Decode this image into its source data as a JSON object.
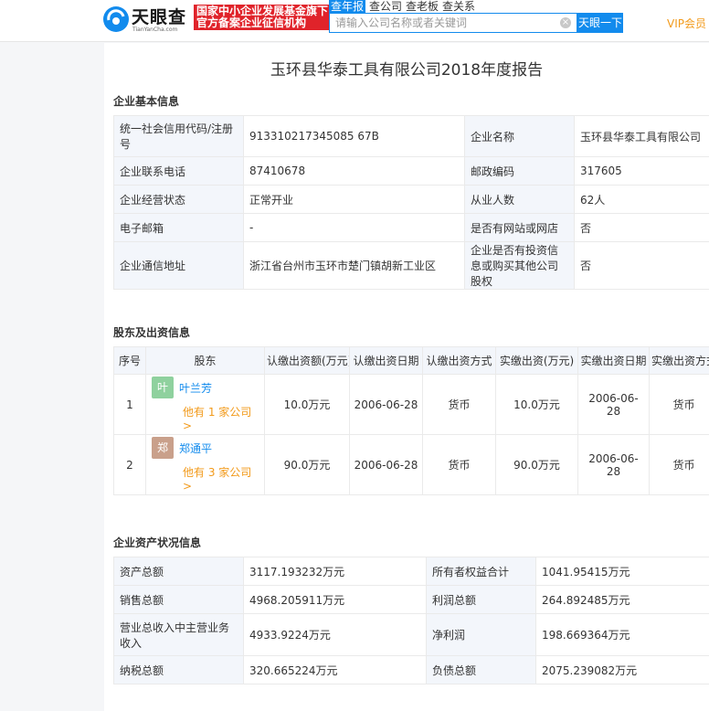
{
  "header": {
    "logo_text": "天眼查",
    "logo_sub": "TianYanCha.com",
    "badge_line1": "国家中小企业发展基金旗下",
    "badge_line2": "官方备案企业征信机构",
    "tabs": [
      "查年报",
      "查公司",
      "查老板",
      "查关系"
    ],
    "search_placeholder": "请输入公司名称或者关键词",
    "search_button": "天眼一下",
    "vip": "VIP会员",
    "accent_color": "#128bed"
  },
  "report": {
    "title": "玉环县华泰工具有限公司2018年度报告"
  },
  "basic": {
    "section_title": "企业基本信息",
    "rows": [
      [
        "统一社会信用代码/注册号",
        "913310217345085 67B",
        "企业名称",
        "玉环县华泰工具有限公司"
      ],
      [
        "企业联系电话",
        "87410678",
        "邮政编码",
        "317605"
      ],
      [
        "企业经营状态",
        "正常开业",
        "从业人数",
        "62人"
      ],
      [
        "电子邮箱",
        "-",
        "是否有网站或网店",
        "否"
      ],
      [
        "企业通信地址",
        "浙江省台州市玉环市楚门镇胡新工业区",
        "企业是否有投资信息或购买其他公司股权",
        "否"
      ]
    ]
  },
  "shareholders": {
    "section_title": "股东及出资信息",
    "headers": [
      "序号",
      "股东",
      "认缴出资额(万元)",
      "认缴出资日期",
      "认缴出资方式",
      "实缴出资(万元)",
      "实缴出资日期",
      "实缴出资方式"
    ],
    "rows": [
      {
        "no": "1",
        "avatar": "叶",
        "name": "叶兰芳",
        "more": "他有 1 家公司 >",
        "sub_amount": "10.0万元",
        "sub_date": "2006-06-28",
        "sub_method": "货币",
        "paid_amount": "10.0万元",
        "paid_date": "2006-06-28",
        "paid_method": "货币",
        "avatar_color": "#8fd19e"
      },
      {
        "no": "2",
        "avatar": "郑",
        "name": "郑通平",
        "more": "他有 3 家公司 >",
        "sub_amount": "90.0万元",
        "sub_date": "2006-06-28",
        "sub_method": "货币",
        "paid_amount": "90.0万元",
        "paid_date": "2006-06-28",
        "paid_method": "货币",
        "avatar_color": "#c9a08b"
      }
    ]
  },
  "assets": {
    "section_title": "企业资产状况信息",
    "rows": [
      [
        "资产总额",
        "3117.193232万元",
        "所有者权益合计",
        "1041.95415万元"
      ],
      [
        "销售总额",
        "4968.205911万元",
        "利润总额",
        "264.892485万元"
      ],
      [
        "营业总收入中主营业务收入",
        "4933.9224万元",
        "净利润",
        "198.669364万元"
      ],
      [
        "纳税总额",
        "320.665224万元",
        "负债总额",
        "2075.239082万元"
      ]
    ]
  }
}
